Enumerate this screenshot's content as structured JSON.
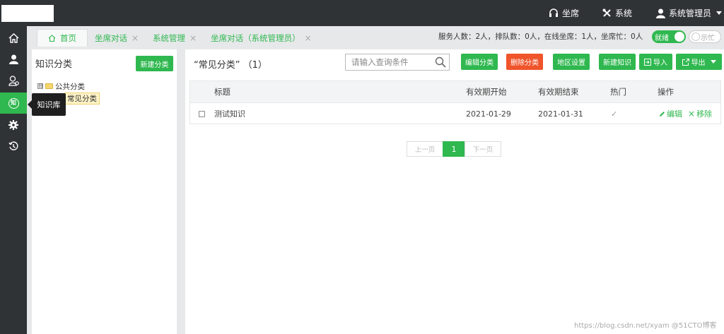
{
  "topbar": {
    "seat_label": "坐席",
    "system_label": "系统",
    "user_label": "系统管理员"
  },
  "rail": {
    "active_item_text": "知",
    "tooltip": "知识库"
  },
  "tabs": [
    {
      "label": "首页",
      "closable": false
    },
    {
      "label": "坐席对话",
      "closable": true
    },
    {
      "label": "系统管理",
      "closable": true
    },
    {
      "label": "坐席对话（系统管理员）",
      "closable": true
    }
  ],
  "status": {
    "text": "服务人数：2人，排队数：0人，在线坐席：1人，坐席忙：0人",
    "ready_toggle": "就绪",
    "busy_toggle": "示忙"
  },
  "left_panel": {
    "title": "知识分类",
    "new_category_button": "新建分类",
    "tree": {
      "root": {
        "expander": "⊟",
        "label": "公共分类"
      },
      "child": {
        "label": "常见分类"
      }
    }
  },
  "right_panel": {
    "heading": "“常见分类” （1）",
    "search_placeholder": "请输入查询条件",
    "buttons": {
      "edit_category": "编辑分类",
      "delete_category": "删除分类",
      "region_settings": "地区设置",
      "new_knowledge": "新建知识",
      "import": "导入",
      "export": "导出"
    },
    "table": {
      "columns": {
        "title": "标题",
        "start": "有效期开始",
        "end": "有效期结束",
        "hot": "热门",
        "actions": "操作"
      },
      "rows": [
        {
          "title": "测试知识",
          "start": "2021-01-29",
          "end": "2021-01-31",
          "hot": "✓",
          "edit": "编辑",
          "remove": "移除"
        }
      ]
    },
    "pager": {
      "prev": "上一页",
      "current": "1",
      "next": "下一页"
    }
  },
  "watermark": "https://blog.csdn.net/xyam  @51CTO博客",
  "colors": {
    "accent": "#2fb84f",
    "danger": "#f0542b",
    "topbar": "#2f3336"
  }
}
